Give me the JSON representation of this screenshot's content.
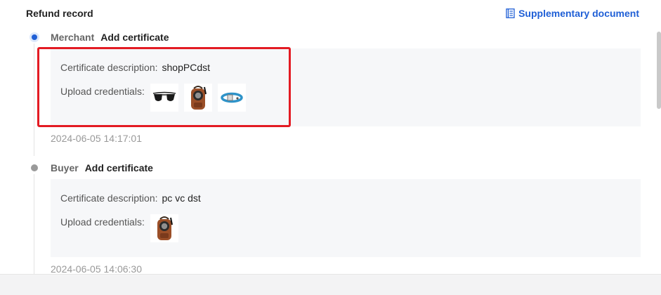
{
  "header": {
    "title": "Refund record",
    "supplementary_label": "Supplementary document",
    "accent_color": "#1f5fd6"
  },
  "entries": [
    {
      "role": "Merchant",
      "action": "Add certificate",
      "description_label": "Certificate description",
      "description_value": "shopPCdst",
      "upload_label": "Upload credentials",
      "thumbnails": [
        "sunglasses-image",
        "backpack-image",
        "dog-collar-image"
      ],
      "timestamp": "2024-06-05 14:17:01",
      "status": "active"
    },
    {
      "role": "Buyer",
      "action": "Add certificate",
      "description_label": "Certificate description",
      "description_value": "pc vc dst",
      "upload_label": "Upload credentials",
      "thumbnails": [
        "backpack-image"
      ],
      "timestamp": "2024-06-05 14:06:30",
      "status": "inactive"
    }
  ],
  "annotation_color": "#e31b23"
}
